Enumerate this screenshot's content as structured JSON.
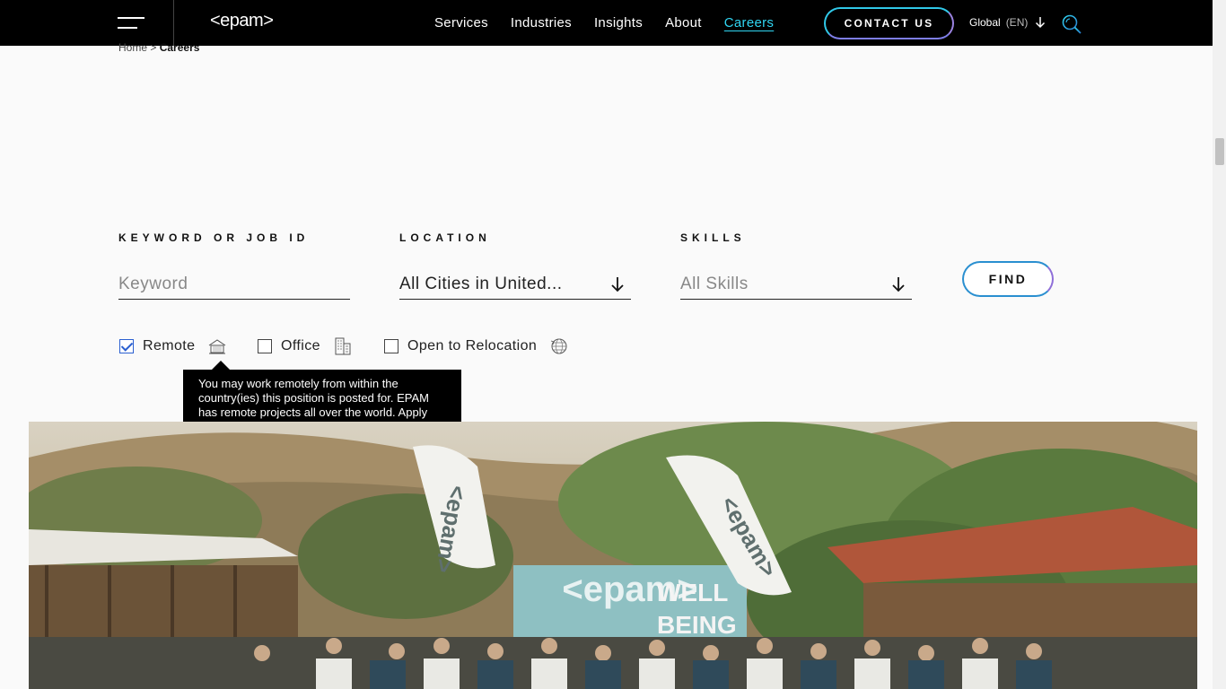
{
  "header": {
    "logo": "<epam>",
    "nav": [
      {
        "label": "Services",
        "active": false
      },
      {
        "label": "Industries",
        "active": false
      },
      {
        "label": "Insights",
        "active": false
      },
      {
        "label": "About",
        "active": false
      },
      {
        "label": "Careers",
        "active": true
      }
    ],
    "contact_label": "CONTACT US",
    "lang_region": "Global",
    "lang_code": "(EN)"
  },
  "breadcrumb": {
    "home": "Home",
    "separator": ">",
    "current": "Careers"
  },
  "search": {
    "keyword_label": "KEYWORD OR JOB ID",
    "keyword_placeholder": "Keyword",
    "location_label": "LOCATION",
    "location_value": "All Cities in United...",
    "skills_label": "SKILLS",
    "skills_value": "All Skills",
    "find_label": "FIND"
  },
  "filters": [
    {
      "label": "Remote",
      "checked": true,
      "icon": "house-laptop-icon"
    },
    {
      "label": "Office",
      "checked": false,
      "icon": "office-building-icon"
    },
    {
      "label": "Open to Relocation",
      "checked": false,
      "icon": "globe-arrows-icon"
    }
  ],
  "tooltip": {
    "text": "You may work remotely from within the country(ies) this position is posted for. EPAM has remote projects all over the world. Apply today to learn more."
  },
  "hero": {
    "flag_text_1": "<epam>",
    "flag_text_2": "<epam>",
    "banner_logo": "<epam>",
    "banner_text_1": "WELL",
    "banner_text_2": "BEING"
  },
  "colors": {
    "header_bg": "#000000",
    "accent_cyan": "#30d5f2",
    "accent_purple": "#8e6ed8",
    "checkbox_blue": "#2a5fd0"
  }
}
